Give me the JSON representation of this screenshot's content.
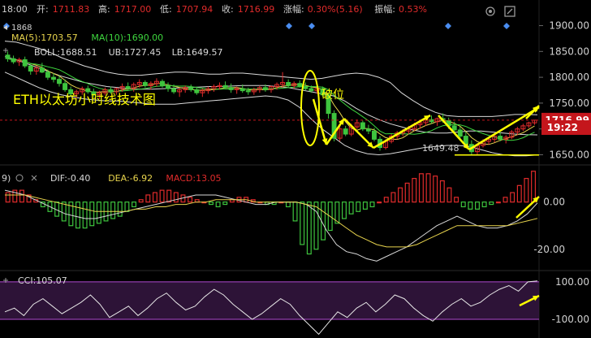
{
  "header": {
    "time": "18:00",
    "open_label": "开:",
    "open": "1711.83",
    "high_label": "高:",
    "high": "1717.00",
    "low_label": "低:",
    "low": "1707.94",
    "close_label": "收:",
    "close": "1716.99",
    "change_label": "涨幅:",
    "change": "0.30%(5.16)",
    "amplitude_label": "振幅:",
    "amplitude": "0.53%"
  },
  "top_right_icons": [
    "settings-icon",
    "expand-icon"
  ],
  "main_panel": {
    "peak_value": "1868",
    "ma_legend": [
      {
        "text": "MA(5):1703.57",
        "color": "#e8d44d"
      },
      {
        "text": "MA(10):1690.00",
        "color": "#3ed63e"
      }
    ],
    "boll_legend": [
      {
        "text": "BOLL:1688.51",
        "color": "#d9d9d9"
      },
      {
        "text": "UB:1727.45",
        "color": "#d9d9d9"
      },
      {
        "text": "LB:1649.57",
        "color": "#d9d9d9"
      }
    ],
    "title_annotation": "ETH以太坊小时线技术图",
    "breakout_annotation": "破位",
    "low_marker": "1649.48",
    "price_tag": "1716.99",
    "time_tag": "19:22",
    "y_ticks": [
      "1900.00",
      "1850.00",
      "1800.00",
      "1750.00",
      "1700.00",
      "1650.00"
    ]
  },
  "macd_panel": {
    "legend": [
      {
        "text": "DIF:-0.40",
        "color": "#d9d9d9"
      },
      {
        "text": "DEA:-6.92",
        "color": "#e8d44d"
      },
      {
        "text": "MACD:13.05",
        "color": "#e02b2b"
      }
    ],
    "y_ticks": [
      "0.00",
      "-20.00"
    ]
  },
  "cci_panel": {
    "legend": [
      {
        "text": "CCI:105.07",
        "color": "#d9d9d9"
      }
    ],
    "y_ticks": [
      "100.00",
      "-100.00"
    ]
  },
  "colors": {
    "up": "#e02b2b",
    "down": "#3ec43e",
    "boll": "#d9d9d9",
    "ma5": "#e8d44d",
    "ma10": "#3ed63e",
    "annotation": "#ffff00",
    "price_tag_bg": "#c4161c"
  },
  "chart_data": [
    {
      "type": "candlestick",
      "title": "ETH以太坊小时线技术图",
      "ylim": [
        1635,
        1915
      ],
      "y_ticks": [
        1900,
        1850,
        1800,
        1750,
        1700,
        1650
      ],
      "peak_value": 1868,
      "low_marker": 1649.48,
      "last_price": 1716.99,
      "indicators": {
        "MA5": 1703.57,
        "MA10": 1690.0,
        "BOLL": 1688.51,
        "UB": 1727.45,
        "LB": 1649.57
      },
      "candles": [
        [
          1843,
          1850,
          1830,
          1836
        ],
        [
          1836,
          1842,
          1826,
          1830
        ],
        [
          1830,
          1838,
          1822,
          1834
        ],
        [
          1834,
          1840,
          1818,
          1822
        ],
        [
          1822,
          1826,
          1805,
          1812
        ],
        [
          1812,
          1822,
          1805,
          1818
        ],
        [
          1818,
          1828,
          1808,
          1810
        ],
        [
          1810,
          1815,
          1795,
          1800
        ],
        [
          1800,
          1808,
          1790,
          1796
        ],
        [
          1796,
          1804,
          1782,
          1788
        ],
        [
          1788,
          1796,
          1772,
          1776
        ],
        [
          1776,
          1782,
          1762,
          1768
        ],
        [
          1768,
          1776,
          1760,
          1772
        ],
        [
          1772,
          1782,
          1766,
          1778
        ],
        [
          1778,
          1784,
          1768,
          1772
        ],
        [
          1772,
          1778,
          1762,
          1766
        ],
        [
          1766,
          1774,
          1758,
          1770
        ],
        [
          1770,
          1780,
          1765,
          1776
        ],
        [
          1776,
          1782,
          1768,
          1772
        ],
        [
          1772,
          1780,
          1766,
          1778
        ],
        [
          1778,
          1788,
          1772,
          1782
        ],
        [
          1782,
          1790,
          1774,
          1778
        ],
        [
          1778,
          1790,
          1772,
          1786
        ],
        [
          1786,
          1796,
          1780,
          1790
        ],
        [
          1790,
          1794,
          1780,
          1784
        ],
        [
          1784,
          1792,
          1776,
          1788
        ],
        [
          1788,
          1798,
          1782,
          1792
        ],
        [
          1792,
          1796,
          1780,
          1784
        ],
        [
          1784,
          1790,
          1772,
          1778
        ],
        [
          1778,
          1786,
          1768,
          1772
        ],
        [
          1772,
          1780,
          1762,
          1776
        ],
        [
          1776,
          1784,
          1770,
          1780
        ],
        [
          1780,
          1786,
          1772,
          1776
        ],
        [
          1776,
          1782,
          1766,
          1770
        ],
        [
          1770,
          1778,
          1762,
          1774
        ],
        [
          1774,
          1782,
          1768,
          1778
        ],
        [
          1778,
          1786,
          1772,
          1782
        ],
        [
          1782,
          1790,
          1776,
          1784
        ],
        [
          1784,
          1792,
          1778,
          1780
        ],
        [
          1780,
          1788,
          1770,
          1776
        ],
        [
          1776,
          1782,
          1768,
          1778
        ],
        [
          1778,
          1786,
          1770,
          1774
        ],
        [
          1774,
          1780,
          1766,
          1772
        ],
        [
          1772,
          1780,
          1766,
          1776
        ],
        [
          1776,
          1784,
          1770,
          1780
        ],
        [
          1780,
          1786,
          1772,
          1776
        ],
        [
          1776,
          1784,
          1770,
          1782
        ],
        [
          1782,
          1790,
          1776,
          1786
        ],
        [
          1786,
          1810,
          1780,
          1790
        ],
        [
          1790,
          1796,
          1780,
          1784
        ],
        [
          1784,
          1792,
          1778,
          1788
        ],
        [
          1788,
          1794,
          1780,
          1782
        ],
        [
          1782,
          1790,
          1774,
          1778
        ],
        [
          1778,
          1784,
          1770,
          1774
        ],
        [
          1774,
          1782,
          1768,
          1778
        ],
        [
          1778,
          1782,
          1762,
          1766
        ],
        [
          1766,
          1770,
          1720,
          1730
        ],
        [
          1730,
          1736,
          1676,
          1682
        ],
        [
          1682,
          1706,
          1676,
          1700
        ],
        [
          1700,
          1706,
          1686,
          1690
        ],
        [
          1690,
          1710,
          1686,
          1704
        ],
        [
          1704,
          1718,
          1700,
          1712
        ],
        [
          1712,
          1716,
          1696,
          1700
        ],
        [
          1700,
          1708,
          1690,
          1696
        ],
        [
          1696,
          1702,
          1676,
          1680
        ],
        [
          1680,
          1686,
          1658,
          1664
        ],
        [
          1664,
          1680,
          1660,
          1676
        ],
        [
          1676,
          1690,
          1672,
          1686
        ],
        [
          1686,
          1696,
          1680,
          1692
        ],
        [
          1692,
          1700,
          1686,
          1696
        ],
        [
          1696,
          1706,
          1690,
          1700
        ],
        [
          1700,
          1712,
          1696,
          1708
        ],
        [
          1708,
          1716,
          1700,
          1712
        ],
        [
          1712,
          1722,
          1706,
          1718
        ],
        [
          1718,
          1726,
          1710,
          1714
        ],
        [
          1714,
          1722,
          1706,
          1720
        ],
        [
          1720,
          1730,
          1712,
          1716
        ],
        [
          1716,
          1722,
          1700,
          1706
        ],
        [
          1706,
          1714,
          1692,
          1698
        ],
        [
          1698,
          1704,
          1680,
          1686
        ],
        [
          1686,
          1694,
          1664,
          1670
        ],
        [
          1670,
          1678,
          1650,
          1656
        ],
        [
          1656,
          1672,
          1650,
          1668
        ],
        [
          1668,
          1680,
          1664,
          1676
        ],
        [
          1676,
          1684,
          1670,
          1680
        ],
        [
          1680,
          1690,
          1674,
          1686
        ],
        [
          1686,
          1694,
          1676,
          1680
        ],
        [
          1680,
          1688,
          1672,
          1684
        ],
        [
          1684,
          1698,
          1680,
          1694
        ],
        [
          1694,
          1704,
          1688,
          1700
        ],
        [
          1700,
          1710,
          1696,
          1706
        ],
        [
          1706,
          1714,
          1702,
          1711.83
        ],
        [
          1711.83,
          1717.0,
          1707.94,
          1716.99
        ]
      ],
      "bollinger": {
        "upper": [
          1870,
          1868,
          1862,
          1856,
          1848,
          1838,
          1830,
          1822,
          1816,
          1810,
          1806,
          1804,
          1804,
          1806,
          1808,
          1810,
          1810,
          1808,
          1806,
          1806,
          1808,
          1808,
          1806,
          1804,
          1802,
          1800,
          1798,
          1796,
          1798,
          1802,
          1806,
          1808,
          1806,
          1800,
          1790,
          1770,
          1755,
          1742,
          1732,
          1726,
          1724,
          1724,
          1724,
          1724,
          1726,
          1728,
          1728,
          1727.45
        ],
        "mid": [
          1840,
          1834,
          1826,
          1818,
          1810,
          1802,
          1796,
          1790,
          1786,
          1782,
          1780,
          1778,
          1777,
          1777,
          1778,
          1779,
          1780,
          1781,
          1782,
          1782,
          1783,
          1784,
          1784,
          1784,
          1782,
          1780,
          1776,
          1772,
          1768,
          1764,
          1754,
          1740,
          1728,
          1718,
          1710,
          1704,
          1698,
          1694,
          1692,
          1692,
          1694,
          1696,
          1696,
          1694,
          1692,
          1690,
          1689,
          1688.51
        ],
        "lower": [
          1810,
          1800,
          1790,
          1780,
          1772,
          1766,
          1762,
          1758,
          1756,
          1754,
          1754,
          1752,
          1750,
          1748,
          1748,
          1748,
          1750,
          1752,
          1754,
          1756,
          1758,
          1760,
          1762,
          1764,
          1762,
          1756,
          1742,
          1720,
          1700,
          1684,
          1668,
          1658,
          1652,
          1650,
          1652,
          1656,
          1660,
          1664,
          1666,
          1668,
          1668,
          1666,
          1660,
          1654,
          1650,
          1648,
          1648,
          1649.57
        ]
      }
    },
    {
      "type": "bar",
      "title": "MACD",
      "ylim": [
        -28,
        14
      ],
      "y_ticks": [
        0,
        -20
      ],
      "indicators": {
        "DIF": -0.4,
        "DEA": -6.92,
        "MACD": 13.05
      },
      "histogram": [
        4,
        5,
        5,
        3,
        1,
        -2,
        -4,
        -6,
        -8,
        -10,
        -11,
        -11,
        -10,
        -9,
        -8,
        -7,
        -6,
        -4,
        -2,
        1,
        3,
        4,
        5,
        5,
        4,
        3,
        2,
        1,
        0,
        -1,
        -2,
        -1,
        1,
        2,
        2,
        1,
        0,
        -1,
        -1,
        0,
        -2,
        -8,
        -18,
        -22,
        -20,
        -16,
        -12,
        -9,
        -7,
        -5,
        -4,
        -3,
        -2,
        0,
        2,
        4,
        6,
        8,
        10,
        12,
        12,
        11,
        9,
        6,
        2,
        -2,
        -3,
        -3,
        -2,
        -1,
        0,
        2,
        4,
        7,
        10,
        13.05
      ],
      "dif": [
        5,
        4,
        3,
        1,
        -1,
        -3,
        -5,
        -6,
        -7,
        -7,
        -6,
        -5,
        -4,
        -3,
        -2,
        -1,
        0,
        1,
        2,
        3,
        3,
        3,
        2,
        1,
        0,
        -1,
        -1,
        0,
        0,
        0,
        -1,
        -4,
        -12,
        -18,
        -21,
        -22,
        -24,
        -25,
        -23,
        -21,
        -19,
        -16,
        -13,
        -10,
        -8,
        -6,
        -8,
        -10,
        -11,
        -11,
        -10,
        -8,
        -5,
        -0.4
      ],
      "dea": [
        3,
        3,
        3,
        2,
        1,
        0,
        -1,
        -2,
        -3,
        -4,
        -4,
        -4,
        -4,
        -3,
        -3,
        -2,
        -2,
        -1,
        -1,
        0,
        0,
        1,
        1,
        1,
        1,
        0,
        0,
        0,
        0,
        0,
        -1,
        -2,
        -5,
        -8,
        -11,
        -14,
        -16,
        -18,
        -19,
        -19,
        -19,
        -18,
        -16,
        -14,
        -12,
        -10,
        -10,
        -10,
        -10,
        -10,
        -10,
        -9,
        -8,
        -6.92
      ]
    },
    {
      "type": "line",
      "title": "CCI",
      "ylim": [
        -200,
        130
      ],
      "y_ticks": [
        100,
        -100
      ],
      "indicators": {
        "CCI": 105.07
      },
      "values": [
        -60,
        -40,
        -80,
        -20,
        10,
        -30,
        -70,
        -40,
        -10,
        30,
        -20,
        -90,
        -60,
        -30,
        -80,
        -40,
        10,
        40,
        -10,
        -50,
        -30,
        20,
        60,
        30,
        -20,
        -60,
        -100,
        -70,
        -30,
        10,
        -20,
        -80,
        -130,
        -180,
        -120,
        -60,
        -90,
        -40,
        -10,
        -60,
        -20,
        30,
        10,
        -40,
        -80,
        -110,
        -60,
        -20,
        10,
        -30,
        -10,
        30,
        60,
        80,
        50,
        100,
        105.07
      ]
    }
  ]
}
